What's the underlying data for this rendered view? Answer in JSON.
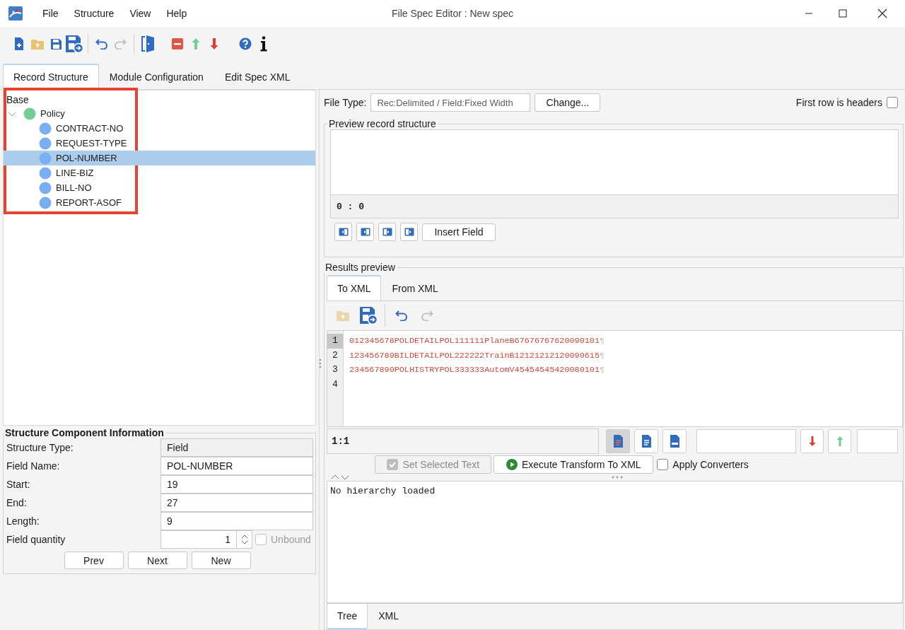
{
  "window": {
    "title": "File Spec Editor : New spec"
  },
  "menu": [
    "File",
    "Structure",
    "View",
    "Help"
  ],
  "toolbar": [
    {
      "kind": "new",
      "disabled": false
    },
    {
      "kind": "open",
      "disabled": false
    },
    {
      "kind": "save",
      "disabled": false
    },
    {
      "kind": "save_as",
      "disabled": false
    },
    {
      "kind": "separator"
    },
    {
      "kind": "undo",
      "disabled": false
    },
    {
      "kind": "redo",
      "disabled": true
    },
    {
      "kind": "separator"
    },
    {
      "kind": "exit",
      "disabled": false
    },
    {
      "kind": "remove",
      "disabled": false
    },
    {
      "kind": "move_up",
      "disabled": false
    },
    {
      "kind": "move_down",
      "disabled": false
    },
    {
      "kind": "help",
      "disabled": false
    },
    {
      "kind": "info",
      "disabled": false
    }
  ],
  "tabs": [
    {
      "label": "Record Structure",
      "selected": true
    },
    {
      "label": "Module Configuration",
      "selected": false
    },
    {
      "label": "Edit Spec XML",
      "selected": false
    }
  ],
  "tree": {
    "label": "Base",
    "children": [
      {
        "label": "Policy",
        "kind": "record",
        "expanded": true,
        "selected": false,
        "children": [
          {
            "label": "CONTRACT-NO",
            "kind": "field",
            "selected": false
          },
          {
            "label": "REQUEST-TYPE",
            "kind": "field",
            "selected": false
          },
          {
            "label": "POL-NUMBER",
            "kind": "field",
            "selected": true
          },
          {
            "label": "LINE-BIZ",
            "kind": "field",
            "selected": false
          },
          {
            "label": "BILL-NO",
            "kind": "field",
            "selected": false
          },
          {
            "label": "REPORT-ASOF",
            "kind": "field",
            "selected": false
          }
        ]
      }
    ]
  },
  "component_info": {
    "title": "Structure Component Information",
    "fields": [
      {
        "label": "Structure Type:",
        "value": "Field",
        "kind": "readonly"
      },
      {
        "label": "Field Name:",
        "value": "POL-NUMBER",
        "kind": "text"
      },
      {
        "label": "Start:",
        "value": "19",
        "kind": "text"
      },
      {
        "label": "End:",
        "value": "27",
        "kind": "text"
      },
      {
        "label": "Length:",
        "value": "9",
        "kind": "text"
      }
    ],
    "quantity": {
      "label": "Field quantity",
      "value": "1"
    },
    "unbound": {
      "label": "Unbound",
      "checked": false,
      "disabled": true
    },
    "buttons": [
      "Prev",
      "Next",
      "New"
    ]
  },
  "file_type": {
    "label": "File Type:",
    "value": "Rec:Delimited / Field:Fixed Width",
    "button": "Change...",
    "headers": {
      "label": "First row is headers",
      "checked": false
    }
  },
  "preview": {
    "title": "Preview record structure",
    "position": "0 : 0",
    "button": "Insert Field"
  },
  "results": {
    "title": "Results preview",
    "tabs": [
      {
        "label": "To XML",
        "selected": true
      },
      {
        "label": "From XML",
        "selected": false
      }
    ],
    "toolbar": [
      {
        "kind": "open",
        "disabled": true
      },
      {
        "kind": "save_as",
        "disabled": false
      },
      {
        "kind": "separator"
      },
      {
        "kind": "undo",
        "disabled": false
      },
      {
        "kind": "redo",
        "disabled": true
      }
    ],
    "lines": [
      {
        "number": "1",
        "text": "012345678POLDETAILPOL111111PlaneB67676767620090101",
        "eol": "¶",
        "current": true
      },
      {
        "number": "2",
        "text": "123456789BILDETAILPOL222222TrainB12121212120090615",
        "eol": "¶",
        "current": false
      },
      {
        "number": "3",
        "text": "234567890POLHISTRYPOL333333AutomV45454545420080101",
        "eol": "¶",
        "current": false
      },
      {
        "number": "4",
        "current": false
      }
    ],
    "cursor": "1:1",
    "view_modes": [
      {
        "kind": "text",
        "selected": true
      },
      {
        "kind": "document",
        "selected": false
      },
      {
        "kind": "html",
        "selected": false
      }
    ],
    "set_selected": {
      "label": "Set Selected Text",
      "checked": true,
      "disabled": true
    },
    "execute": "Execute Transform To XML",
    "apply_converters": {
      "label": "Apply Converters",
      "checked": false
    },
    "output": "No hierarchy loaded",
    "bottom_tabs": [
      {
        "label": "Tree",
        "selected": true
      },
      {
        "label": "XML",
        "selected": false
      }
    ]
  }
}
